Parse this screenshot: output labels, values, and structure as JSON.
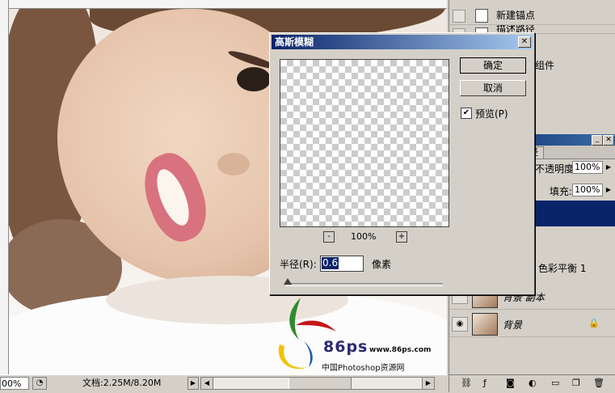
{
  "dialog": {
    "title": "高斯模糊",
    "ok_label": "确定",
    "cancel_label": "取消",
    "preview_label": "预览(P)",
    "preview_checked": true,
    "zoom_value": "100%",
    "zoom_minus": "-",
    "zoom_plus": "+",
    "radius_label": "半径(R):",
    "radius_value": "0.6",
    "unit_label": "像素",
    "close_glyph": "✕"
  },
  "history": {
    "items": [
      {
        "label": "新建锚点"
      },
      {
        "label": "描述路径"
      },
      {
        "label": "组件"
      }
    ]
  },
  "layers": {
    "tab_label": "径",
    "opacity_label": "不透明度:",
    "opacity_value": "100%",
    "fill_label": "填充:",
    "fill_value": "100%",
    "rows": [
      {
        "name": "色彩平衡 1"
      },
      {
        "name": "背景 副本"
      },
      {
        "name": "背景"
      }
    ]
  },
  "statusbar": {
    "zoom": "00%",
    "doc_size": "文档:2.25M/8.20M"
  },
  "watermark": {
    "brand": "86ps",
    "url": "www.86ps.com",
    "subtitle": "中国Photoshop资源网"
  },
  "colors": {
    "title_bar_start": "#0a246a",
    "title_bar_end": "#a6caf0",
    "selected_layer": "#0a246a",
    "window_face": "#d4d0c8"
  }
}
